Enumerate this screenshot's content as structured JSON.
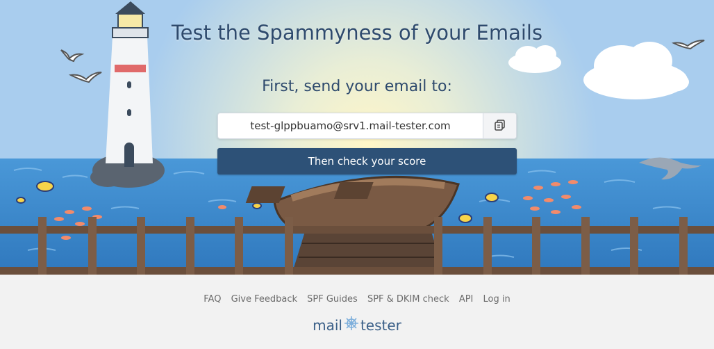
{
  "hero": {
    "title": "Test the Spammyness of your Emails",
    "subtitle": "First, send your email to:",
    "email_address": "test-glppbuamo@srv1.mail-tester.com",
    "copy_icon": "copy-icon",
    "check_button_label": "Then check your score"
  },
  "footer": {
    "links": [
      "FAQ",
      "Give Feedback",
      "SPF Guides",
      "SPF & DKIM check",
      "API",
      "Log in"
    ],
    "logo_left": "mail",
    "logo_right": "tester",
    "logo_icon": "ship-wheel-icon"
  },
  "colors": {
    "accent": "#2d5177",
    "title": "#2e4a6d",
    "sky": "#a9cdee",
    "sea": "#3d8bd0",
    "footer_bg": "#f2f2f2"
  }
}
